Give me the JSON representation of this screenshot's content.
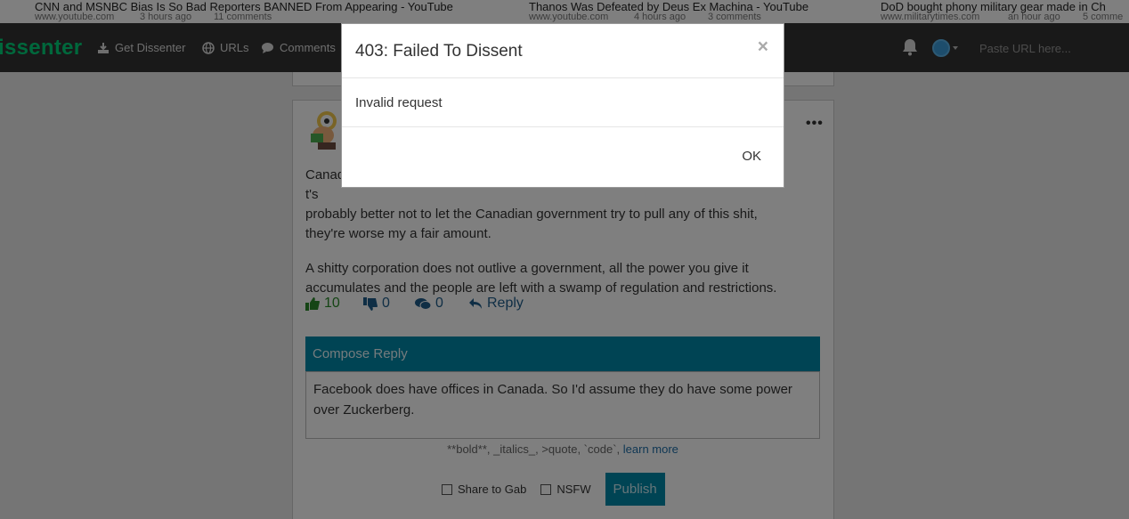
{
  "ticker": [
    {
      "title": "CNN and MSNBC Bias Is So Bad Reporters BANNED From Appearing - YouTube",
      "domain": "www.youtube.com",
      "time": "3 hours ago",
      "comments": "11 comments"
    },
    {
      "title": "Thanos Was Defeated by Deus Ex Machina - YouTube",
      "domain": "www.youtube.com",
      "time": "4 hours ago",
      "comments": "3 comments"
    },
    {
      "title": "DoD bought phony military gear made in Ch",
      "domain": "www.militarytimes.com",
      "time": "an hour ago",
      "comments": "5 comme"
    }
  ],
  "navbar": {
    "brand": "issenter",
    "links": [
      {
        "label": "Get Dissenter",
        "icon": "download-icon"
      },
      {
        "label": "URLs",
        "icon": "globe-icon"
      },
      {
        "label": "Comments",
        "icon": "comment-icon"
      }
    ],
    "url_placeholder": "Paste URL here..."
  },
  "comment": {
    "paragraph1": "Canad                                                                                                          t's probably better not to let the Canadian government try to pull any of this shit, they're worse my a fair amount.",
    "paragraph1_visible_start": "Canad",
    "paragraph1_visible_end": "t's",
    "paragraph1_line2": "probably better not to let the Canadian government try to pull any of this shit,",
    "paragraph1_line3": "they're worse my a fair amount.",
    "paragraph2": "A shitty corporation does not outlive a government, all the power you give it accumulates and the people are left with a swamp of regulation and restrictions.",
    "upvotes": "10",
    "downvotes": "0",
    "replies": "0",
    "reply_label": "Reply",
    "more": "•••"
  },
  "compose": {
    "header": "Compose Reply",
    "text": "Facebook does have offices in Canada. So I'd assume they do have some power over Zuckerberg.",
    "markdown_hint": "**bold**, _italics_, >quote, `code`,",
    "learn_more": "learn more",
    "share_gab": "Share to Gab",
    "nsfw": "NSFW",
    "publish": "Publish"
  },
  "modal": {
    "title": "403: Failed To Dissent",
    "close": "×",
    "message": "Invalid request",
    "ok": "OK"
  },
  "colors": {
    "brand": "#00d178",
    "navbar": "#333333",
    "accent": "#0088a8",
    "upvote": "#2a8a2a",
    "link": "#1f5c8a"
  }
}
